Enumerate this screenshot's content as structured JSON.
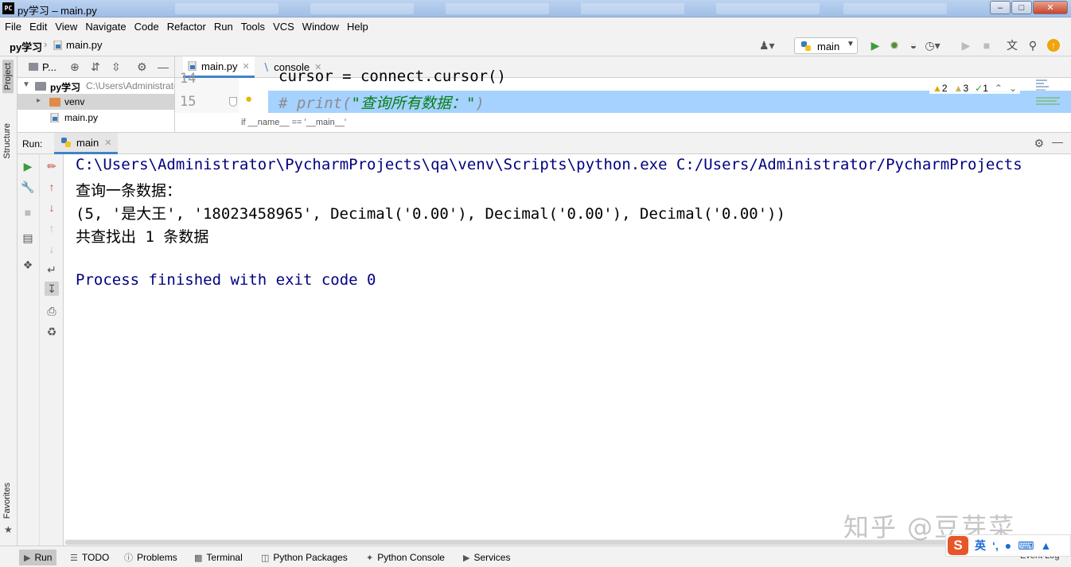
{
  "window": {
    "title": "py学习 – main.py",
    "app_icon": "PC"
  },
  "menu": [
    "File",
    "Edit",
    "View",
    "Navigate",
    "Code",
    "Refactor",
    "Run",
    "Tools",
    "VCS",
    "Window",
    "Help"
  ],
  "navbar": {
    "project": "py学习",
    "file": "main.py",
    "run_config": "main"
  },
  "left_strip": {
    "project": "Project",
    "structure": "Structure",
    "favorites": "Favorites"
  },
  "project_panel": {
    "header": "P...",
    "root_name": "py学习",
    "root_path": "C:\\Users\\Administrator",
    "items": [
      "venv",
      "main.py"
    ]
  },
  "editor": {
    "tabs": [
      {
        "label": "main.py",
        "active": true
      },
      {
        "label": "console",
        "active": false
      }
    ],
    "line14_no": "14",
    "line14_code": "cursor = connect.cursor()",
    "line15_no": "15",
    "line15_comment_prefix": "# print(",
    "line15_string": "\"查询所有数据：\"",
    "line15_comment_suffix": ")",
    "breadcrumb": "if __name__ == '__main__'",
    "warnings": "2",
    "weak_warnings": "3",
    "ok": "1"
  },
  "run": {
    "label": "Run:",
    "tab": "main",
    "output": [
      "C:\\Users\\Administrator\\PycharmProjects\\qa\\venv\\Scripts\\python.exe C:/Users/Administrator/PycharmProjects",
      "查询一条数据：",
      "(5, '是大王', '18023458965', Decimal('0.00'), Decimal('0.00'), Decimal('0.00'))",
      "共查找出 1 条数据",
      "",
      "Process finished with exit code 0"
    ]
  },
  "watermark": "知乎 @豆芽菜",
  "bottom_tools": [
    "Run",
    "TODO",
    "Problems",
    "Terminal",
    "Python Packages",
    "Python Console",
    "Services"
  ],
  "status_right": "Event Log",
  "ime": {
    "logo": "S",
    "lang": "英"
  },
  "colors": {
    "selection_line": "#a6d2ff",
    "console_process_text": "#000080",
    "comment": "#8c8c8c",
    "comment_string": "#067d17",
    "run_green": "#3a9d3a",
    "tab_underline": "#4083c9"
  }
}
